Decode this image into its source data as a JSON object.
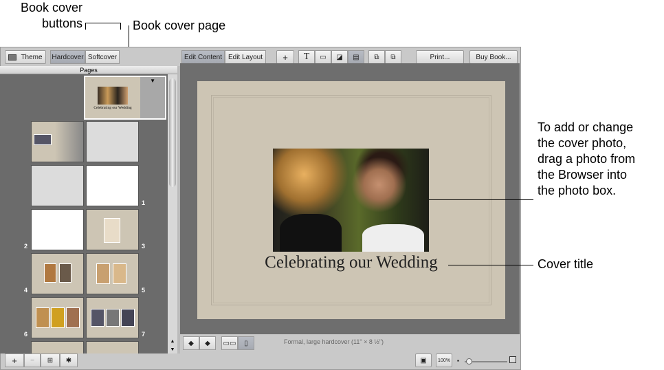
{
  "annotations": {
    "cover_buttons": "Book cover\nbuttons",
    "cover_page": "Book cover page",
    "cover_photo": "To add or change\nthe cover photo,\ndrag a photo from\nthe Browser into\nthe photo box.",
    "cover_title": "Cover title"
  },
  "toolbar": {
    "theme": "Theme",
    "hardcover": "Hardcover",
    "softcover": "Softcover",
    "edit_content": "Edit Content",
    "edit_layout": "Edit Layout",
    "add": "+",
    "text": "T",
    "print": "Print...",
    "buy_book": "Buy Book..."
  },
  "sidebar": {
    "header": "Pages",
    "page_numbers": [
      "1",
      "2",
      "3",
      "4",
      "5",
      "6",
      "7"
    ]
  },
  "canvas": {
    "cover_title": "Celebrating our Wedding",
    "thumb_title": "Celebrating our Wedding",
    "book_info": "Formal, large hardcover (11\" × 8 ½\")"
  },
  "bottom": {
    "add": "+",
    "remove": "−",
    "zoom_100": "100%"
  },
  "zoom_slider": {
    "value": 0.05
  },
  "colors": {
    "cover": "#cdc5b4",
    "sidebar": "#6b6b6b",
    "canvas_bg": "#6e6e6e"
  }
}
